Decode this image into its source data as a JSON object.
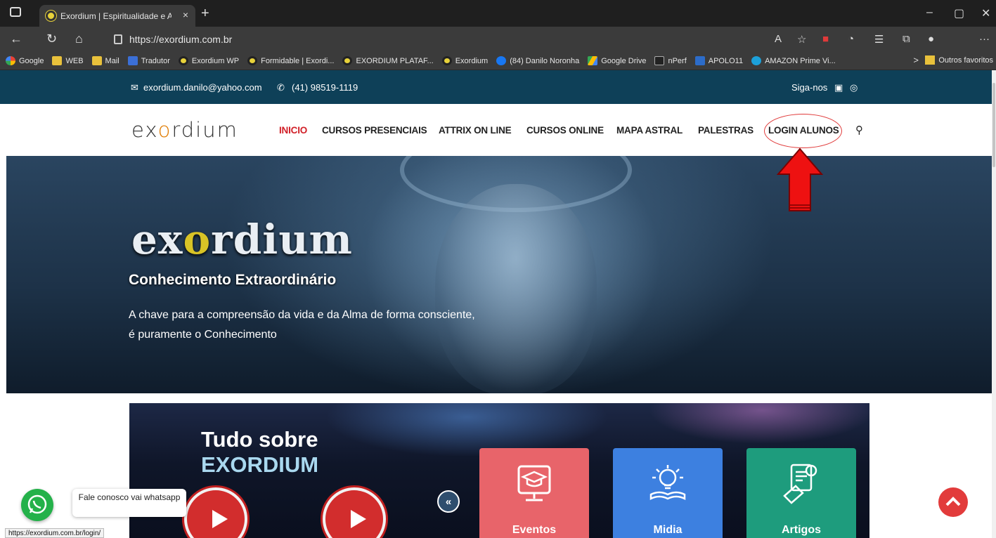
{
  "browser": {
    "tab_title": "Exordium | Espiritualidade e Astr",
    "tab_close": "×",
    "new_tab": "+",
    "url": "https://exordium.com.br",
    "window_controls": [
      "–",
      "▢",
      "✕"
    ],
    "bookmarks": [
      {
        "label": "Google",
        "icon": "google-icon"
      },
      {
        "label": "WEB",
        "icon": "folder-icon"
      },
      {
        "label": "Mail",
        "icon": "folder-icon"
      },
      {
        "label": "Tradutor",
        "icon": "translate-icon"
      },
      {
        "label": "Exordium WP",
        "icon": "exordium-icon"
      },
      {
        "label": "Formidable | Exordi...",
        "icon": "exordium-icon"
      },
      {
        "label": "EXORDIUM PLATAF...",
        "icon": "exordium-icon"
      },
      {
        "label": "Exordium",
        "icon": "exordium-icon"
      },
      {
        "label": "(84) Danilo Noronha",
        "icon": "facebook-icon"
      },
      {
        "label": "Google Drive",
        "icon": "drive-icon"
      },
      {
        "label": "nPerf",
        "icon": "nperf-icon"
      },
      {
        "label": "APOLO11",
        "icon": "tv-icon"
      },
      {
        "label": "AMAZON Prime Vi...",
        "icon": "prime-icon"
      }
    ],
    "bookmarks_more": ">",
    "other_favorites": "Outros favoritos",
    "status_url": "https://exordium.com.br/login/"
  },
  "site": {
    "email": "exordium.danilo@yahoo.com",
    "phone": "(41) 98519-1119",
    "follow": "Siga-nos",
    "logo": {
      "pre": "ex",
      "o": "o",
      "post": "rdium"
    },
    "nav": [
      "INICIO",
      "CURSOS PRESENCIAIS",
      "ATTRIX ON LINE",
      "CURSOS ONLINE",
      "MAPA ASTRAL",
      "PALESTRAS",
      "LOGIN ALUNOS"
    ],
    "hero": {
      "tagline": "Conhecimento Extraordinário",
      "line1": "A chave para a compreensão da vida e da Alma de forma consciente,",
      "line2": "é puramente o Conhecimento"
    },
    "promo": {
      "title1": "Tudo sobre",
      "title2": "EXORDIUM",
      "cards": [
        {
          "label": "Eventos",
          "color": "#e8646a",
          "icon": "graduation-cap-icon"
        },
        {
          "label": "Midia",
          "color": "#3d80e0",
          "icon": "lightbulb-book-icon"
        },
        {
          "label": "Artigos",
          "color": "#1e9c7d",
          "icon": "certificate-icon"
        }
      ],
      "prev": "«",
      "next": "»"
    },
    "whatsapp_text": "Fale conosco vai whatsapp"
  },
  "colors": {
    "topbar": "#0e4058",
    "nav_active": "#d12028",
    "annotation": "#e03a3a"
  }
}
